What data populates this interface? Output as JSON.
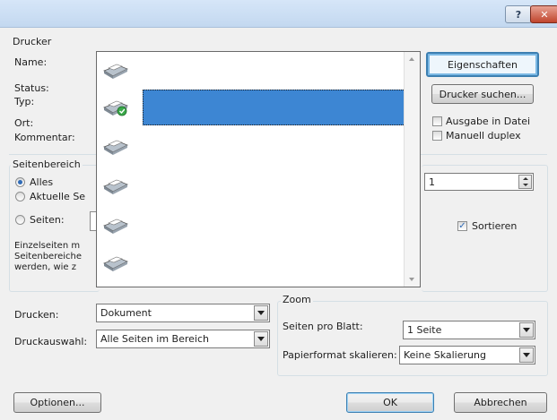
{
  "titlebar": {
    "help_label": "?",
    "close_label": "✕"
  },
  "printer": {
    "group_label": "Drucker",
    "name_label": "Name:",
    "status_label": "Status:",
    "type_label": "Typ:",
    "location_label": "Ort:",
    "comment_label": "Kommentar:",
    "properties_button": "Eigenschaften",
    "find_printer_button": "Drucker suchen...",
    "print_to_file": "Ausgabe in Datei",
    "manual_duplex": "Manuell duplex"
  },
  "page_range": {
    "group_label": "Seitenbereich",
    "all": "Alles",
    "current": "Aktuelle Se",
    "pages": "Seiten:",
    "hint_line1": "Einzelseiten m",
    "hint_line2": "Seitenbereiche",
    "hint_line3": "werden, wie z"
  },
  "copies": {
    "value": "1",
    "collate": "Sortieren"
  },
  "print_what": {
    "label": "Drucken:",
    "value": "Dokument"
  },
  "print_selection": {
    "label": "Druckauswahl:",
    "value": "Alle Seiten im Bereich"
  },
  "zoom": {
    "group_label": "Zoom",
    "pages_per_sheet_label": "Seiten pro Blatt:",
    "pages_per_sheet_value": "1 Seite",
    "scale_label": "Papierformat skalieren:",
    "scale_value": "Keine Skalierung"
  },
  "footer": {
    "options_button": "Optionen...",
    "ok_button": "OK",
    "cancel_button": "Abbrechen"
  },
  "colors": {
    "selection": "#3d86d3",
    "focus_border": "#3c7fb1"
  }
}
